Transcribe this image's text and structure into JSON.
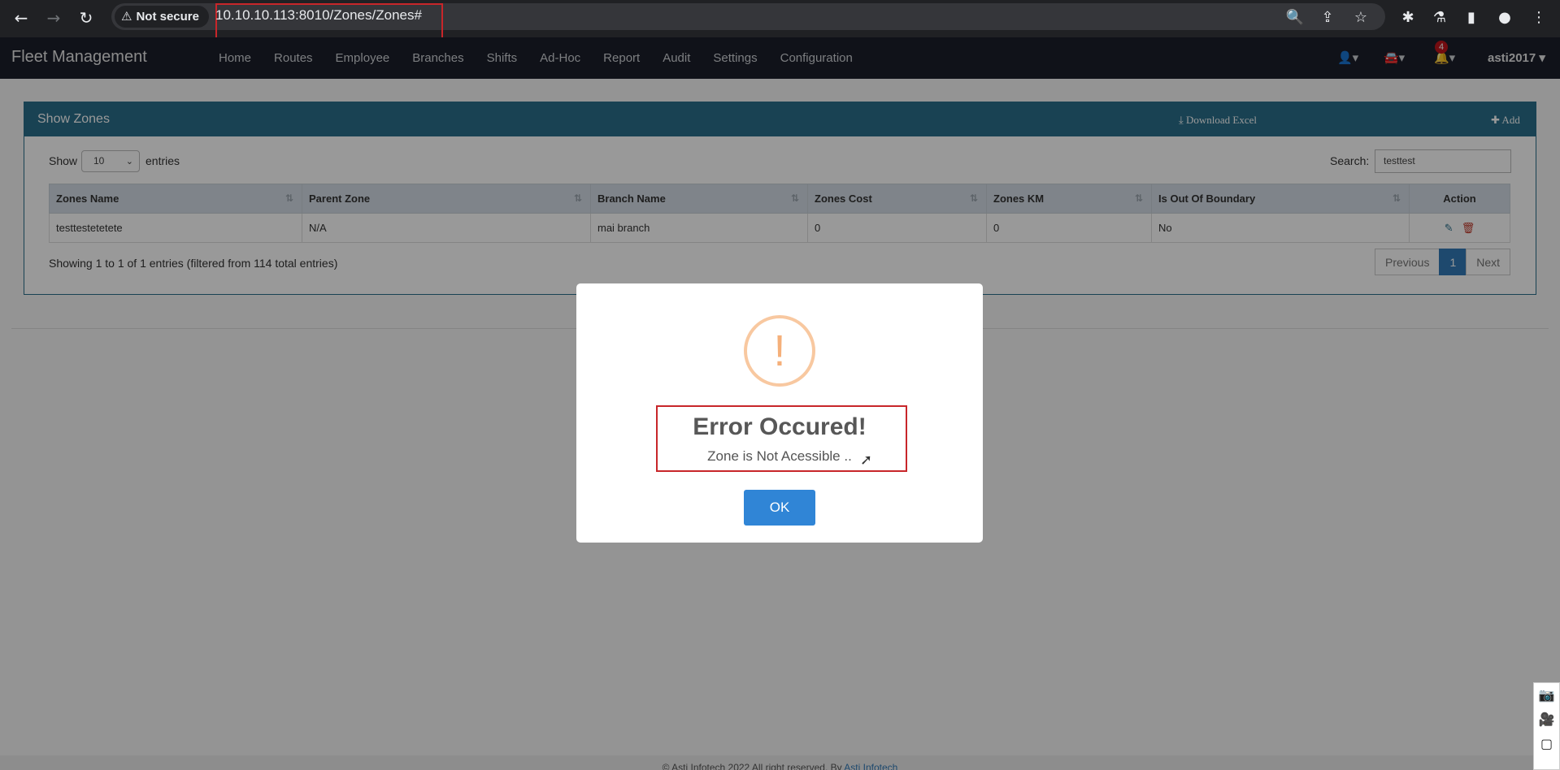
{
  "browser": {
    "back": "←",
    "forward": "→",
    "reload": "↻",
    "security_label": "Not secure",
    "warn_icon": "⚠",
    "url": "10.10.10.113:8010/Zones/Zones#",
    "zoom_icon": "🔍",
    "share_icon": "⇪",
    "star_icon": "☆",
    "extensions_icon": "✱",
    "labs_icon": "⚗",
    "sidepanel_icon": "▮",
    "profile_icon": "●",
    "menu_icon": "⋮"
  },
  "navbar": {
    "brand": "Fleet Management",
    "menu": [
      "Home",
      "Routes",
      "Employee",
      "Branches",
      "Shifts",
      "Ad-Hoc",
      "Report",
      "Audit",
      "Settings",
      "Configuration"
    ],
    "user_icon": "👤▾",
    "car_icon": "🚘▾",
    "bell_icon": "🔔▾",
    "notification_count": "4",
    "username": "asti2017 ▾"
  },
  "panel": {
    "title": "Show Zones",
    "download_label": "⤓ Download Excel",
    "add_label": "✚ Add",
    "show_label": "Show",
    "page_length": "10",
    "entries_label": "entries",
    "search_label": "Search:",
    "search_value": "testtest",
    "columns": [
      "Zones Name",
      "Parent Zone",
      "Branch Name",
      "Zones Cost",
      "Zones KM",
      "Is Out Of Boundary",
      "Action"
    ],
    "rows": [
      {
        "zones_name": "testtestetetete",
        "parent_zone": "N/A",
        "branch_name": "mai branch",
        "zones_cost": "0",
        "zones_km": "0",
        "out_of_boundary": "No"
      }
    ],
    "info": "Showing 1 to 1 of 1 entries (filtered from 114 total entries)",
    "pagination": {
      "previous": "Previous",
      "current": "1",
      "next": "Next"
    }
  },
  "footer": {
    "text": "© Asti Infotech 2022 All right reserved. By",
    "link": "Asti Infotech"
  },
  "modal": {
    "icon": "!",
    "title": "Error Occured!",
    "message": "Zone is Not Acessible ..",
    "ok_label": "OK"
  },
  "colors": {
    "navbar": "#1b1e2b",
    "panel_header": "#2a6f8b",
    "ok_button": "#3085d6",
    "highlight_box": "#c8262a"
  }
}
